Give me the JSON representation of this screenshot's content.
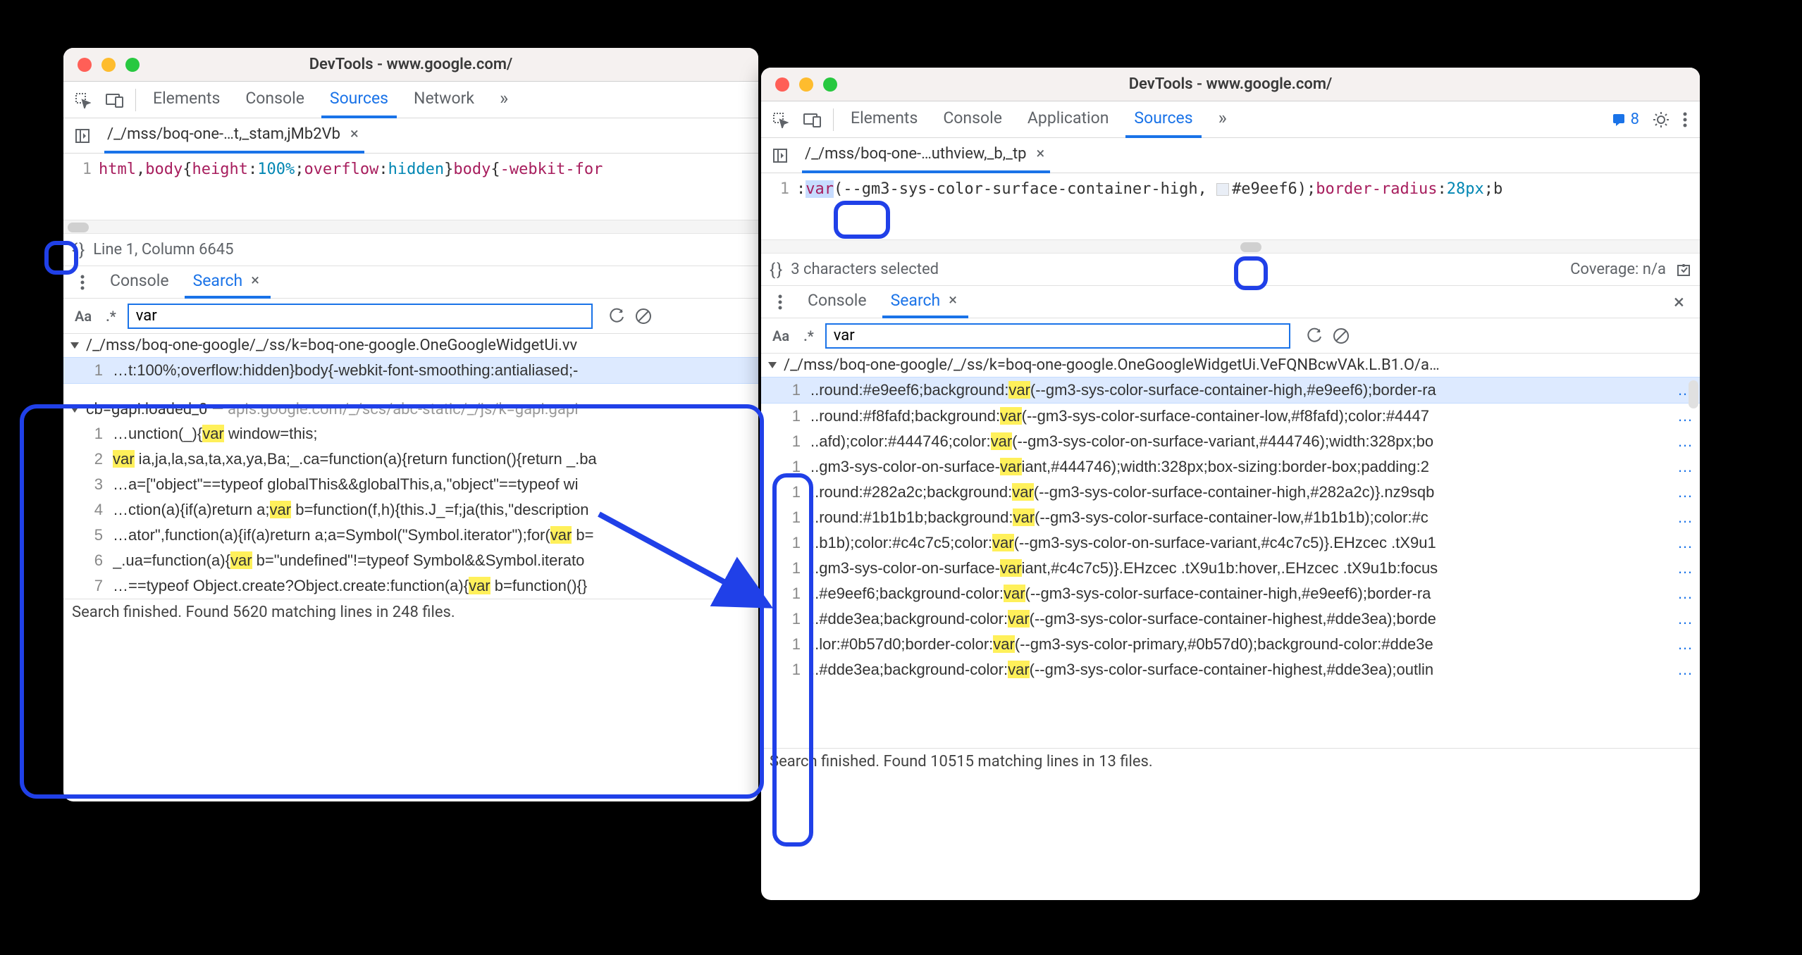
{
  "left": {
    "title": "DevTools - www.google.com/",
    "tabs": {
      "elements": "Elements",
      "console": "Console",
      "sources": "Sources",
      "network": "Network",
      "more": "»"
    },
    "breadcrumb": "/_/mss/boq-one-…t,_stam,jMb2Vb",
    "code": {
      "line_no": "1",
      "t1": "html",
      "c1": ",",
      "t2": "body",
      "b1": "{",
      "p1": "height",
      "col1": ":",
      "v1": "100%",
      "sc1": ";",
      "p2": "overflow",
      "col2": ":",
      "v2": "hidden",
      "b2": "}",
      "t3": "body",
      "b3": "{",
      "p3": "-webkit-for"
    },
    "status": "Line 1, Column 6645",
    "drawer": {
      "console": "Console",
      "search": "Search"
    },
    "search_value": "var",
    "results": {
      "group1": "/_/mss/boq-one-google/_/ss/k=boq-one-google.OneGoogleWidgetUi.vv",
      "group1_line": {
        "n": "1",
        "text": "…t:100%;overflow:hidden}body{-webkit-font-smoothing:antialiased;-"
      },
      "group2_main": "cb=gapi.loaded_0",
      "group2_dim": " — apis.google.com/_/scs/abc-static/_/js/k=gapi.gapi",
      "lines": [
        {
          "n": "1",
          "pre": "…unction(_){",
          "m": "var",
          "post": " window=this;"
        },
        {
          "n": "2",
          "pre": "",
          "m": "var",
          "post": " ia,ja,la,sa,ta,xa,ya,Ba;_.ca=function(a){return function(){return _.ba"
        },
        {
          "n": "3",
          "pre": "…a=[\"object\"==typeof globalThis&&globalThis,a,\"object\"==typeof wi",
          "m": "",
          "post": ""
        },
        {
          "n": "4",
          "pre": "…ction(a){if(a)return a;",
          "m": "var",
          "post": " b=function(f,h){this.J_=f;ja(this,\"description"
        },
        {
          "n": "5",
          "pre": "…ator\",function(a){if(a)return a;a=Symbol(\"Symbol.iterator\");for(",
          "m": "var",
          "post": " b="
        },
        {
          "n": "6",
          "pre": "_.ua=function(a){",
          "m": "var",
          "post": " b=\"undefined\"!=typeof Symbol&&Symbol.iterato"
        },
        {
          "n": "7",
          "pre": "…==typeof Object.create?Object.create:function(a){",
          "m": "var",
          "post": " b=function(){}"
        }
      ]
    },
    "footer": "Search finished.  Found 5620 matching lines in 248 files."
  },
  "right": {
    "title": "DevTools - www.google.com/",
    "tabs": {
      "elements": "Elements",
      "console": "Console",
      "application": "Application",
      "sources": "Sources",
      "more": "»"
    },
    "msg_count": "8",
    "breadcrumb": "/_/mss/boq-one-…uthview,_b,_tp",
    "code": {
      "line_no": "1",
      "pre1": ":",
      "sel": "var",
      "pre2": "(--gm3-sys-color-surface-container-high, ",
      "hex": "#e9eef6",
      "post1": ");",
      "p1": "border-radius",
      "col1": ":",
      "v1": "28px",
      "sc1": ";",
      "tail": "b"
    },
    "status_left": "3 characters selected",
    "status_right": "Coverage: n/a",
    "drawer": {
      "console": "Console",
      "search": "Search"
    },
    "search_value": "var",
    "results": {
      "group1": "/_/mss/boq-one-google/_/ss/k=boq-one-google.OneGoogleWidgetUi.VeFQNBcwVAk.L.B1.O/a…",
      "lines": [
        {
          "n": "1",
          "pre": "..round:#e9eef6;background:",
          "m": "var",
          "post": "(--gm3-sys-color-surface-container-high,#e9eef6);border-ra",
          "hl": true
        },
        {
          "n": "1",
          "pre": "..round:#f8fafd;background:",
          "m": "var",
          "post": "(--gm3-sys-color-surface-container-low,#f8fafd);color:#4447"
        },
        {
          "n": "1",
          "pre": "..afd);color:#444746;color:",
          "m": "var",
          "post": "(--gm3-sys-color-on-surface-variant,#444746);width:328px;bo"
        },
        {
          "n": "1",
          "pre": "..gm3-sys-color-on-surface-",
          "m": "var",
          "post": "iant,#444746);width:328px;box-sizing:border-box;padding:2"
        },
        {
          "n": "1",
          "pre": "..round:#282a2c;background:",
          "m": "var",
          "post": "(--gm3-sys-color-surface-container-high,#282a2c)}.nz9sqb"
        },
        {
          "n": "1",
          "pre": "..round:#1b1b1b;background:",
          "m": "var",
          "post": "(--gm3-sys-color-surface-container-low,#1b1b1b);color:#c"
        },
        {
          "n": "1",
          "pre": "..b1b);color:#c4c7c5;color:",
          "m": "var",
          "post": "(--gm3-sys-color-on-surface-variant,#c4c7c5)}.EHzcec .tX9u1"
        },
        {
          "n": "1",
          "pre": "..gm3-sys-color-on-surface-",
          "m": "var",
          "post": "iant,#c4c7c5)}.EHzcec .tX9u1b:hover,.EHzcec .tX9u1b:focus"
        },
        {
          "n": "1",
          "pre": "..#e9eef6;background-color:",
          "m": "var",
          "post": "(--gm3-sys-color-surface-container-high,#e9eef6);border-ra"
        },
        {
          "n": "1",
          "pre": "..#dde3ea;background-color:",
          "m": "var",
          "post": "(--gm3-sys-color-surface-container-highest,#dde3ea);borde"
        },
        {
          "n": "1",
          "pre": "..lor:#0b57d0;border-color:",
          "m": "var",
          "post": "(--gm3-sys-color-primary,#0b57d0);background-color:#dde3e"
        },
        {
          "n": "1",
          "pre": "..#dde3ea;background-color:",
          "m": "var",
          "post": "(--gm3-sys-color-surface-container-highest,#dde3ea);outlin"
        }
      ]
    },
    "footer": "Search finished.  Found 10515 matching lines in 13 files."
  }
}
